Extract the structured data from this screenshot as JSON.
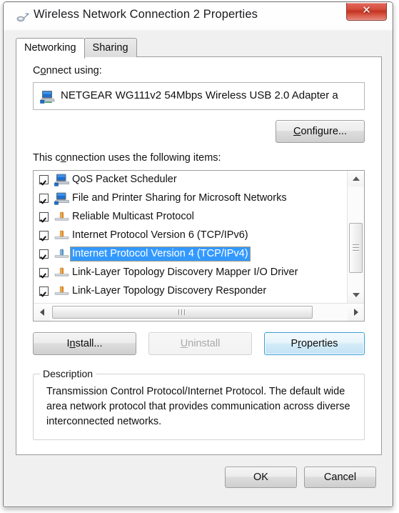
{
  "window": {
    "title": "Wireless Network Connection 2 Properties",
    "title_icon": "wireless-adapter-icon",
    "close_label": "✕",
    "close_icon": "close-icon",
    "accent_blue": "#3399ff",
    "focus_border": "#3c9dd4",
    "close_red": "#c23423"
  },
  "tabs": [
    {
      "label": "Networking",
      "active": true
    },
    {
      "label": "Sharing",
      "active": false
    }
  ],
  "connect_using": {
    "label_pre": "C",
    "label_mnemonic": "o",
    "label_post": "nnect using:",
    "label_full": "Connect using:",
    "adapter_icon": "network-adapter-icon",
    "adapter_name": "NETGEAR WG111v2 54Mbps Wireless USB 2.0 Adapter a",
    "configure_button": {
      "pre": "",
      "mnemonic": "C",
      "post": "onfigure...",
      "full": "Configure..."
    }
  },
  "items_section": {
    "label_pre": "This c",
    "label_mnemonic": "o",
    "label_post": "nnection uses the following items:",
    "label_full": "This connection uses the following items:",
    "items": [
      {
        "label": "QoS Packet Scheduler",
        "checked": true,
        "selected": false,
        "icon": "service-computer-icon"
      },
      {
        "label": "File and Printer Sharing for Microsoft Networks",
        "checked": true,
        "selected": false,
        "icon": "service-computer-icon"
      },
      {
        "label": "Reliable Multicast Protocol",
        "checked": true,
        "selected": false,
        "icon": "protocol-icon"
      },
      {
        "label": "Internet Protocol Version 6 (TCP/IPv6)",
        "checked": true,
        "selected": false,
        "icon": "protocol-icon"
      },
      {
        "label": "Internet Protocol Version 4 (TCP/IPv4)",
        "checked": true,
        "selected": true,
        "icon": "protocol-icon-selected"
      },
      {
        "label": "Link-Layer Topology Discovery Mapper I/O Driver",
        "checked": true,
        "selected": false,
        "icon": "protocol-icon"
      },
      {
        "label": "Link-Layer Topology Discovery Responder",
        "checked": true,
        "selected": false,
        "icon": "protocol-icon"
      }
    ],
    "scroll_up_icon": "scroll-up-arrow-icon",
    "scroll_down_icon": "scroll-down-arrow-icon",
    "scroll_left_icon": "scroll-left-arrow-icon",
    "scroll_right_icon": "scroll-right-arrow-icon"
  },
  "action_buttons": {
    "install": {
      "pre": "I",
      "mnemonic": "n",
      "post": "stall...",
      "full": "Install...",
      "enabled": true
    },
    "uninstall": {
      "pre": "",
      "mnemonic": "U",
      "post": "ninstall",
      "full": "Uninstall",
      "enabled": false
    },
    "properties": {
      "pre": "P",
      "mnemonic": "r",
      "post": "operties",
      "full": "Properties",
      "enabled": true,
      "focused": true
    }
  },
  "description": {
    "title": "Description",
    "text": "Transmission Control Protocol/Internet Protocol. The default wide area network protocol that provides communication across diverse interconnected networks."
  },
  "footer": {
    "ok_label": "OK",
    "cancel_label": "Cancel"
  }
}
